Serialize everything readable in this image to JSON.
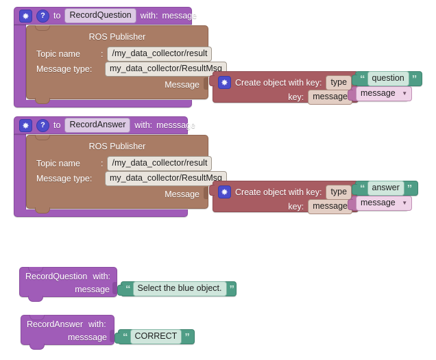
{
  "workspace": {
    "background": "#ffffff",
    "grid_color": "#d8d8d8"
  },
  "colors": {
    "procedure_purple": "#A05CB8",
    "ros_brown": "#A97C65",
    "create_object_maroon": "#A85C62",
    "text_green": "#4F9D86",
    "variable_mauve": "#B974A8",
    "mutator_blue": "#4C4CCB"
  },
  "blocks": [
    {
      "id": "def-record-question",
      "type": "procedure-definition",
      "header": {
        "gear_icon": "gear-icon",
        "help_icon": "question-mark-icon",
        "to_label": "to",
        "procedure_name": "RecordQuestion",
        "with_label": "with:",
        "params": "message"
      },
      "body": {
        "type": "ros-publisher",
        "title": "ROS Publisher",
        "rows": [
          {
            "label": "Topic name",
            "sep": ":",
            "value": "/my_data_collector/result"
          },
          {
            "label": "Message type:",
            "sep": "",
            "value": "my_data_collector/ResultMsg"
          }
        ],
        "message_label": "Message",
        "attached": {
          "type": "create-object",
          "gear_icon": "gear-icon",
          "title": "Create object with key:",
          "entries": [
            {
              "key_label": "",
              "key_value": "type",
              "value_block": {
                "type": "text",
                "text": "question"
              }
            },
            {
              "key_label": "key:",
              "key_value": "message",
              "value_block": {
                "type": "variable",
                "name": "message",
                "dropdown_icon": "chevron-down-icon"
              }
            }
          ]
        }
      }
    },
    {
      "id": "def-record-answer",
      "type": "procedure-definition",
      "header": {
        "gear_icon": "gear-icon",
        "help_icon": "question-mark-icon",
        "to_label": "to",
        "procedure_name": "RecordAnswer",
        "with_label": "with:",
        "params": "messsage"
      },
      "body": {
        "type": "ros-publisher",
        "title": "ROS Publisher",
        "rows": [
          {
            "label": "Topic name",
            "sep": ":",
            "value": "/my_data_collector/result"
          },
          {
            "label": "Message type:",
            "sep": "",
            "value": "my_data_collector/ResultMsg"
          }
        ],
        "message_label": "Message",
        "attached": {
          "type": "create-object",
          "gear_icon": "gear-icon",
          "title": "Create object with key:",
          "entries": [
            {
              "key_label": "",
              "key_value": "type",
              "value_block": {
                "type": "text",
                "text": "answer"
              }
            },
            {
              "key_label": "key:",
              "key_value": "message",
              "value_block": {
                "type": "variable",
                "name": "message",
                "dropdown_icon": "chevron-down-icon"
              }
            }
          ]
        }
      }
    },
    {
      "id": "call-record-question",
      "type": "procedure-call",
      "name": "RecordQuestion",
      "with_label": "with:",
      "arg_label": "message",
      "arg_value": {
        "type": "text",
        "text": "Select the blue object."
      }
    },
    {
      "id": "call-record-answer",
      "type": "procedure-call",
      "name": "RecordAnswer",
      "with_label": "with:",
      "arg_label": "messsage",
      "arg_value": {
        "type": "text",
        "text": "CORRECT"
      }
    }
  ],
  "quotes": {
    "open": "“",
    "close": "”"
  }
}
